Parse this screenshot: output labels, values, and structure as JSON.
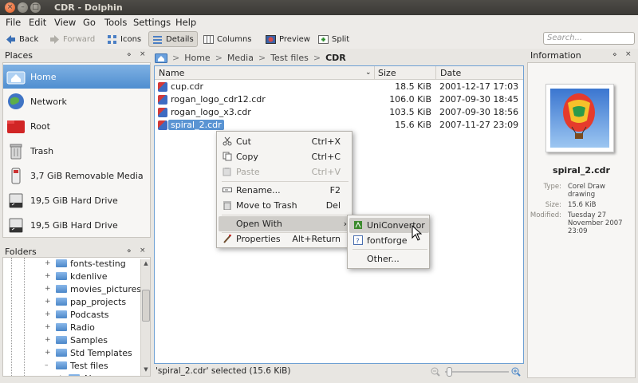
{
  "window": {
    "title": "CDR - Dolphin",
    "buttons": {
      "close": "×",
      "min": "–",
      "max": "□"
    }
  },
  "menu": [
    "File",
    "Edit",
    "View",
    "Go",
    "Tools",
    "Settings",
    "Help"
  ],
  "toolbar": {
    "back": "Back",
    "forward": "Forward",
    "icons": "Icons",
    "details": "Details",
    "columns": "Columns",
    "preview": "Preview",
    "split": "Split",
    "search_placeholder": "Search..."
  },
  "places": {
    "title": "Places",
    "items": [
      {
        "label": "Home"
      },
      {
        "label": "Network"
      },
      {
        "label": "Root"
      },
      {
        "label": "Trash"
      },
      {
        "label": "3,7 GiB Removable Media"
      },
      {
        "label": "19,5 GiB Hard Drive"
      },
      {
        "label": "19,5 GiB Hard Drive"
      }
    ]
  },
  "folders": {
    "title": "Folders",
    "items": [
      {
        "label": "fonts-testing"
      },
      {
        "label": "kdenlive"
      },
      {
        "label": "movies_pictures"
      },
      {
        "label": "pap_projects"
      },
      {
        "label": "Podcasts"
      },
      {
        "label": "Radio"
      },
      {
        "label": "Samples"
      },
      {
        "label": "Std Templates"
      },
      {
        "label": "Test files"
      },
      {
        "label": "AI"
      }
    ]
  },
  "breadcrumb": {
    "home": "Home",
    "media": "Media",
    "testfiles": "Test files",
    "current": "CDR",
    "sep": ">"
  },
  "columns": {
    "name": "Name",
    "size": "Size",
    "date": "Date"
  },
  "files": [
    {
      "name": "cup.cdr",
      "size": "18.5 KiB",
      "date": "2001-12-17 17:03"
    },
    {
      "name": "rogan_logo_cdr12.cdr",
      "size": "106.0 KiB",
      "date": "2007-09-30 18:45"
    },
    {
      "name": "rogan_logo_x3.cdr",
      "size": "103.5 KiB",
      "date": "2007-09-30 18:56"
    },
    {
      "name": "spiral_2.cdr",
      "size": "15.6 KiB",
      "date": "2007-11-27 23:09"
    }
  ],
  "context_menu": {
    "cut": "Cut",
    "cut_sc": "Ctrl+X",
    "copy": "Copy",
    "copy_sc": "Ctrl+C",
    "paste": "Paste",
    "paste_sc": "Ctrl+V",
    "rename": "Rename...",
    "rename_sc": "F2",
    "trash": "Move to Trash",
    "trash_sc": "Del",
    "open_with": "Open With",
    "properties": "Properties",
    "properties_sc": "Alt+Return"
  },
  "submenu": {
    "uniconvertor": "UniConvertor",
    "fontforge": "fontforge",
    "other": "Other..."
  },
  "status": "'spiral_2.cdr' selected (15.6 KiB)",
  "information": {
    "title": "Information",
    "name": "spiral_2.cdr",
    "type_label": "Type:",
    "type_value": "Corel Draw drawing",
    "size_label": "Size:",
    "size_value": "15.6 KiB",
    "modified_label": "Modified:",
    "modified_value": "Tuesday 27 November 2007 23:09"
  },
  "panel_buttons": {
    "float": "⋄",
    "close": "×"
  },
  "colors": {
    "selection": "#5a94d3",
    "accent": "#4f8ed0"
  }
}
